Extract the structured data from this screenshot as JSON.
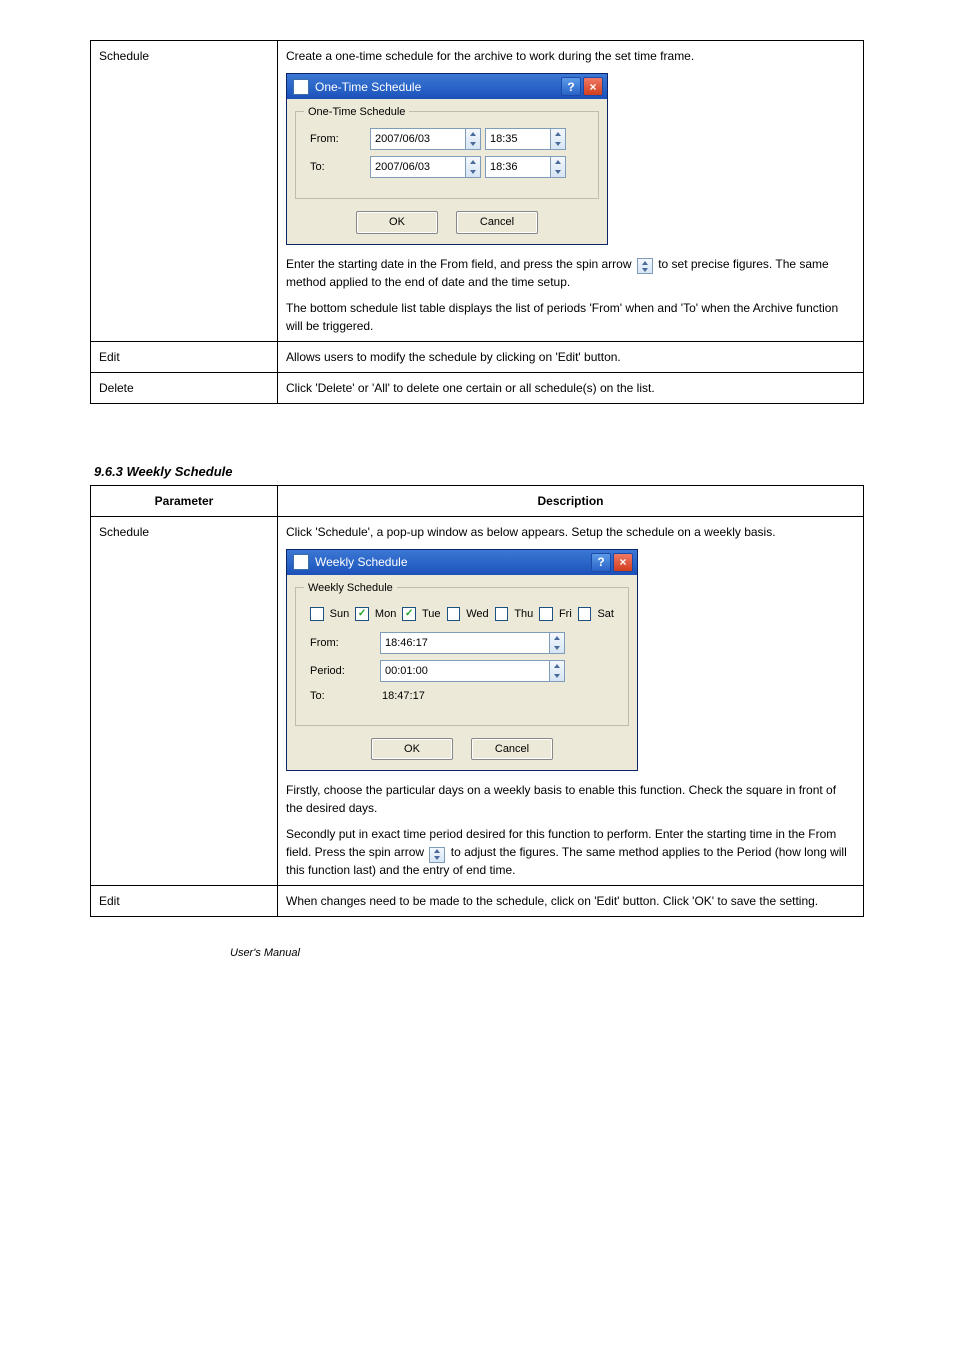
{
  "table1": {
    "col1_label": "Schedule",
    "row1_right_top": "Create a one-time schedule for the archive to work during the set time frame.",
    "dialog1": {
      "title": "One-Time Schedule",
      "group_title": "One-Time Schedule",
      "from_label": "From:",
      "from_date": "2007/06/03",
      "from_time": "18:35",
      "to_label": "To:",
      "to_date": "2007/06/03",
      "to_time": "18:36",
      "ok": "OK",
      "cancel": "Cancel"
    },
    "row1_right_rest_1": "Enter the starting date in the From field, and press the spin arrow ",
    "row1_right_rest_2": " to set precise figures. The same method applied to the end of date and the time setup.",
    "row1_right_rest_3": "The bottom schedule list table displays the list of periods 'From' when and 'To' when the Archive function will be triggered.",
    "row2_left": "Edit",
    "row2_right": "Allows users to modify the schedule by clicking on 'Edit' button.",
    "row3_left": "Delete",
    "row3_right": "Click 'Delete' or 'All' to delete one certain or all schedule(s) on the list."
  },
  "section_heading": "9.6.3 Weekly Schedule",
  "table2": {
    "h1": "Parameter",
    "h2": "Description",
    "row1_left": "Schedule",
    "row1_right_top": "Click 'Schedule', a pop-up window as below appears. Setup the schedule on a weekly basis.",
    "dialog2": {
      "title": "Weekly Schedule",
      "group_title": "Weekly Schedule",
      "days": [
        {
          "label": "Sun",
          "checked": false
        },
        {
          "label": "Mon",
          "checked": true
        },
        {
          "label": "Tue",
          "checked": true
        },
        {
          "label": "Wed",
          "checked": false
        },
        {
          "label": "Thu",
          "checked": false
        },
        {
          "label": "Fri",
          "checked": false
        },
        {
          "label": "Sat",
          "checked": false
        }
      ],
      "from_label": "From:",
      "from_val": "18:46:17",
      "period_label": "Period:",
      "period_val": "00:01:00",
      "to_label": "To:",
      "to_val": "18:47:17",
      "ok": "OK",
      "cancel": "Cancel"
    },
    "row1_right_rest_1": "Firstly, choose the particular days on a weekly basis to enable this function. Check the square in front of the desired days.",
    "row1_right_rest_2": "Secondly put in exact time period desired for this function to perform.  Enter the starting time in the From field. Press the spin arrow ",
    "row1_right_rest_3": " to adjust the figures. The same method applies to the Period (how long will this function last) and the entry of end time.",
    "row2_left": "Edit",
    "row2_right": "When changes need to be made to the schedule, click on 'Edit' button. Click 'OK' to save the setting."
  },
  "footer": "User's Manual"
}
